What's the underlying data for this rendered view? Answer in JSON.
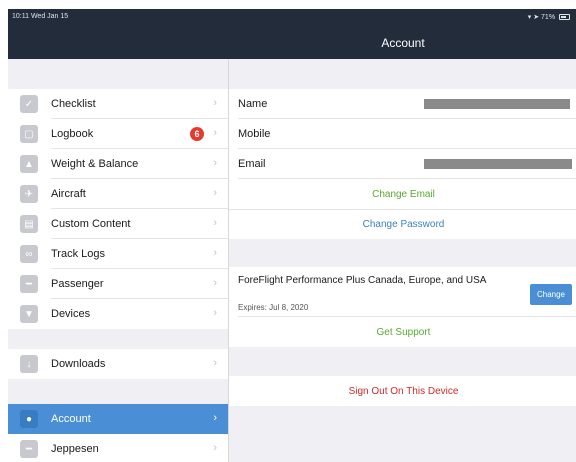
{
  "status": {
    "time_date": "10:11  Wed Jan 15",
    "battery": "71%"
  },
  "nav": {
    "title": "Account"
  },
  "sidebar": {
    "groups": [
      {
        "items": [
          {
            "label": "Checklist"
          },
          {
            "label": "Logbook",
            "badge": "6"
          },
          {
            "label": "Weight & Balance"
          },
          {
            "label": "Aircraft"
          },
          {
            "label": "Custom Content"
          },
          {
            "label": "Track Logs"
          },
          {
            "label": "Passenger"
          },
          {
            "label": "Devices"
          }
        ]
      },
      {
        "items": [
          {
            "label": "Downloads"
          }
        ]
      },
      {
        "items": [
          {
            "label": "Account",
            "selected": true
          },
          {
            "label": "Jeppesen"
          }
        ]
      }
    ]
  },
  "account": {
    "fields": [
      {
        "key": "Name",
        "value_redacted": true
      },
      {
        "key": "Mobile"
      },
      {
        "key": "Email",
        "value_redacted": true
      }
    ],
    "change_email": "Change Email",
    "change_password": "Change Password",
    "plan": {
      "name": "ForeFlight Performance Plus Canada, Europe, and USA",
      "expires": "Expires: Jul 8, 2020",
      "change_label": "Change"
    },
    "get_support": "Get Support",
    "sign_out": "Sign Out On This Device"
  },
  "colors": {
    "accent": "#4a8fd6",
    "nav_bg": "#232c3b",
    "green_link": "#5aa832",
    "destructive": "#cc2b2b",
    "badge": "#e63a2e"
  }
}
